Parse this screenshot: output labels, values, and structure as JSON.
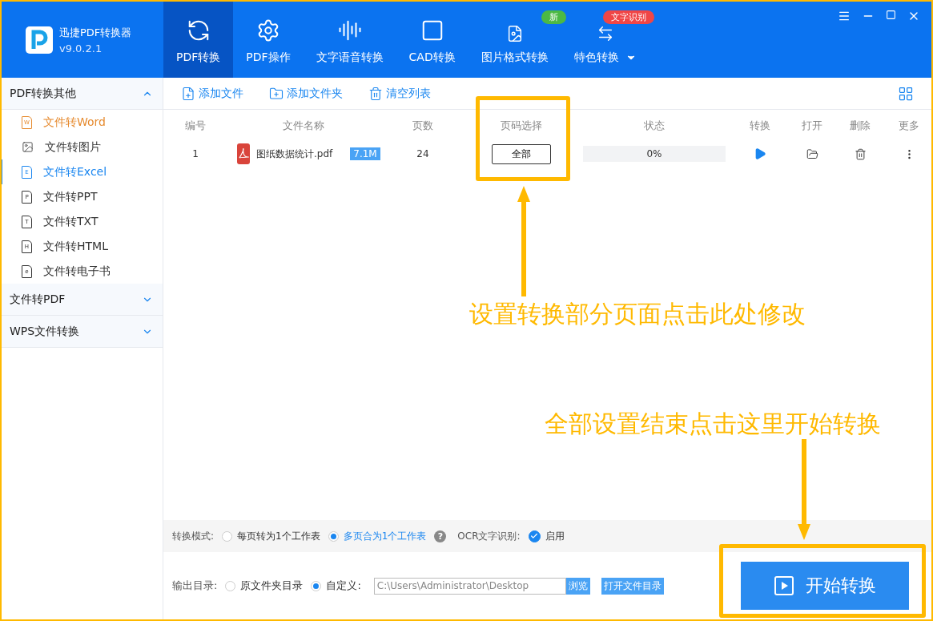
{
  "app": {
    "name": "迅捷PDF转换器",
    "version": "v9.0.2.1"
  },
  "nav_tabs": [
    {
      "label": "PDF转换",
      "selected": true,
      "dropdown": false
    },
    {
      "label": "PDF操作",
      "selected": false,
      "dropdown": false
    },
    {
      "label": "文字语音转换",
      "selected": false,
      "dropdown": false
    },
    {
      "label": "CAD转换",
      "selected": false,
      "dropdown": false
    },
    {
      "label": "图片格式转换",
      "selected": false,
      "dropdown": false,
      "badge": {
        "text": "新",
        "color": "#4cb944"
      }
    },
    {
      "label": "特色转换",
      "selected": false,
      "dropdown": true,
      "badge": {
        "text": "文字识别",
        "color": "#f04646"
      }
    }
  ],
  "sidebar": [
    {
      "label": "PDF转换其他",
      "expanded": true,
      "children": [
        {
          "label": "文件转Word",
          "selected": false,
          "hovered": true,
          "kind": "letter",
          "icon_text": "W"
        },
        {
          "label": "文件转图片",
          "selected": false,
          "hovered": false,
          "kind": "image"
        },
        {
          "label": "文件转Excel",
          "selected": true,
          "hovered": false,
          "kind": "letter",
          "icon_text": "E"
        },
        {
          "label": "文件转PPT",
          "selected": false,
          "hovered": false,
          "kind": "letter",
          "icon_text": "P"
        },
        {
          "label": "文件转TXT",
          "selected": false,
          "hovered": false,
          "kind": "letter",
          "icon_text": "T"
        },
        {
          "label": "文件转HTML",
          "selected": false,
          "hovered": false,
          "kind": "letter",
          "icon_text": "H"
        },
        {
          "label": "文件转电子书",
          "selected": false,
          "hovered": false,
          "kind": "letter",
          "icon_text": "e"
        }
      ]
    },
    {
      "label": "文件转PDF",
      "expanded": false
    },
    {
      "label": "WPS文件转换",
      "expanded": false
    }
  ],
  "toolbar": [
    {
      "label": "添加文件",
      "kind": "file"
    },
    {
      "label": "添加文件夹",
      "kind": "folder"
    },
    {
      "label": "清空列表",
      "kind": "trash"
    }
  ],
  "table": {
    "columns": [
      "编号",
      "文件名称",
      "页数",
      "页码选择",
      "状态",
      "转换",
      "打开",
      "删除",
      "更多"
    ],
    "rows": [
      {
        "index": "1",
        "name": "图纸数据统计.pdf",
        "size": "7.1M",
        "pages": "24",
        "page_select": "全部",
        "status": "0%",
        "level": 0
      }
    ]
  },
  "mode": {
    "label": "转换模式:",
    "options": [
      {
        "label": "每页转为1个工作表",
        "selected": false
      },
      {
        "label": "多页合为1个工作表",
        "selected": true
      }
    ],
    "help": "?",
    "ocr_label": "OCR文字识别:",
    "ocr_checked": true,
    "ocr_text": "启用"
  },
  "output": {
    "label": "输出目录:",
    "options": [
      {
        "label": "原文件夹目录",
        "selected": false
      },
      {
        "label": "自定义:",
        "selected": true
      }
    ],
    "path": "C:\\Users\\Administrator\\Desktop",
    "browse": "浏览",
    "open_dir": "打开文件目录"
  },
  "start_button": "开始转换",
  "annotations": [
    "设置转换部分页面点击此处修改",
    "全部设置结束点击这里开始转换"
  ]
}
